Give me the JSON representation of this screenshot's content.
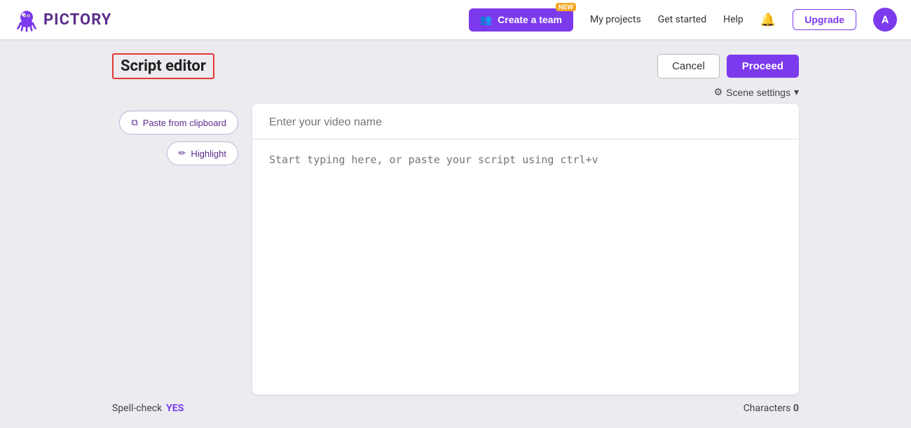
{
  "navbar": {
    "logo_text": "PICTORY",
    "create_team_label": "Create a team",
    "new_badge": "NEW",
    "my_projects": "My projects",
    "get_started": "Get started",
    "help": "Help",
    "upgrade_label": "Upgrade",
    "avatar_initial": "A"
  },
  "header": {
    "title": "Script editor",
    "cancel_label": "Cancel",
    "proceed_label": "Proceed"
  },
  "scene_settings": {
    "label": "Scene settings"
  },
  "sidebar": {
    "paste_label": "Paste from clipboard",
    "highlight_label": "Highlight"
  },
  "editor": {
    "video_name_placeholder": "Enter your video name",
    "script_placeholder": "Start typing here, or paste your script using ctrl+v"
  },
  "footer": {
    "spell_check_label": "Spell-check",
    "spell_check_value": "YES",
    "characters_label": "Characters",
    "characters_value": "0"
  },
  "icons": {
    "team_icon": "👥",
    "bell_icon": "🔔",
    "gear_icon": "⚙",
    "chevron_down": "▾",
    "paste_icon": "⧉",
    "highlight_icon": "✏"
  }
}
